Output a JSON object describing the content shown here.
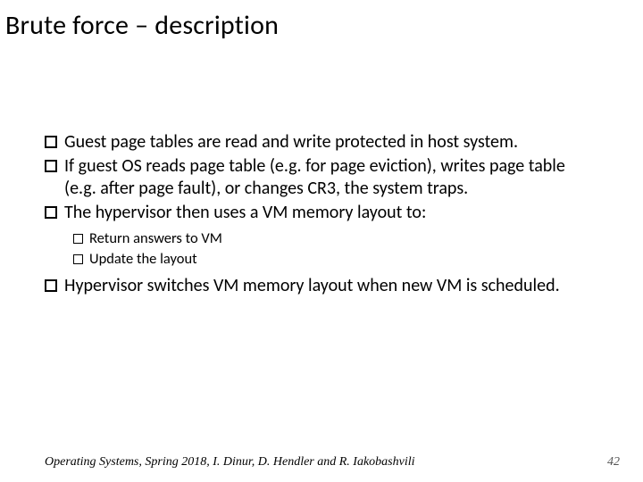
{
  "title": "Brute force – description",
  "bullets": {
    "b1": "Guest page tables are read and write protected in host system.",
    "b2": "If guest OS reads page table (e.g. for page eviction), writes page table (e.g. after page fault), or changes CR3, the system traps.",
    "b3": "The hypervisor then uses a VM memory layout to:",
    "b3a": "Return answers to VM",
    "b3b": "Update the layout",
    "b4": "Hypervisor switches VM memory layout when new VM is scheduled."
  },
  "footer": "Operating Systems, Spring 2018, I. Dinur, D. Hendler and R. Iakobashvili",
  "page_number": "42"
}
